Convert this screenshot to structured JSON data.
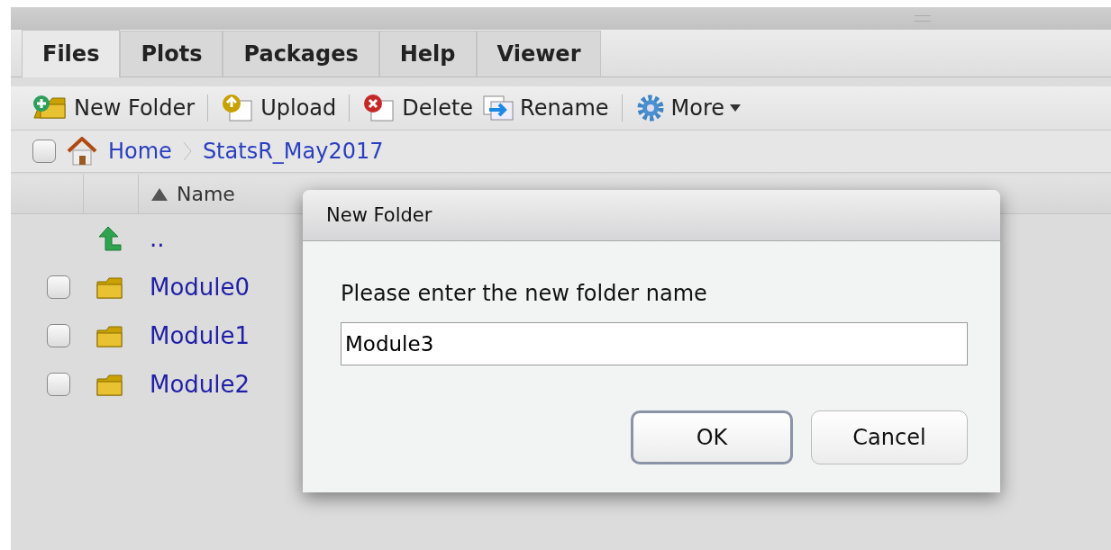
{
  "tabs": [
    {
      "label": "Files",
      "selected": true
    },
    {
      "label": "Plots",
      "selected": false
    },
    {
      "label": "Packages",
      "selected": false
    },
    {
      "label": "Help",
      "selected": false
    },
    {
      "label": "Viewer",
      "selected": false
    }
  ],
  "toolbar": [
    {
      "kind": "new-folder",
      "label": "New Folder"
    },
    {
      "kind": "upload",
      "label": "Upload"
    },
    {
      "kind": "delete",
      "label": "Delete"
    },
    {
      "kind": "rename",
      "label": "Rename"
    },
    {
      "kind": "more",
      "label": "More"
    }
  ],
  "breadcrumb": {
    "checked": false,
    "items": [
      "Home",
      "StatsR_May2017"
    ]
  },
  "table": {
    "columns": [
      {
        "label": "Name",
        "sort_ascending": true
      }
    ],
    "rows": [
      {
        "kind": "parent",
        "name": ".."
      },
      {
        "kind": "folder",
        "name": "Module0",
        "checked": false
      },
      {
        "kind": "folder",
        "name": "Module1",
        "checked": false
      },
      {
        "kind": "folder",
        "name": "Module2",
        "checked": false
      }
    ]
  },
  "dialog": {
    "title": "New Folder",
    "prompt": "Please enter the new folder name",
    "value": "Module3",
    "buttons": [
      {
        "label": "OK",
        "default": true
      },
      {
        "label": "Cancel",
        "default": false
      }
    ]
  }
}
